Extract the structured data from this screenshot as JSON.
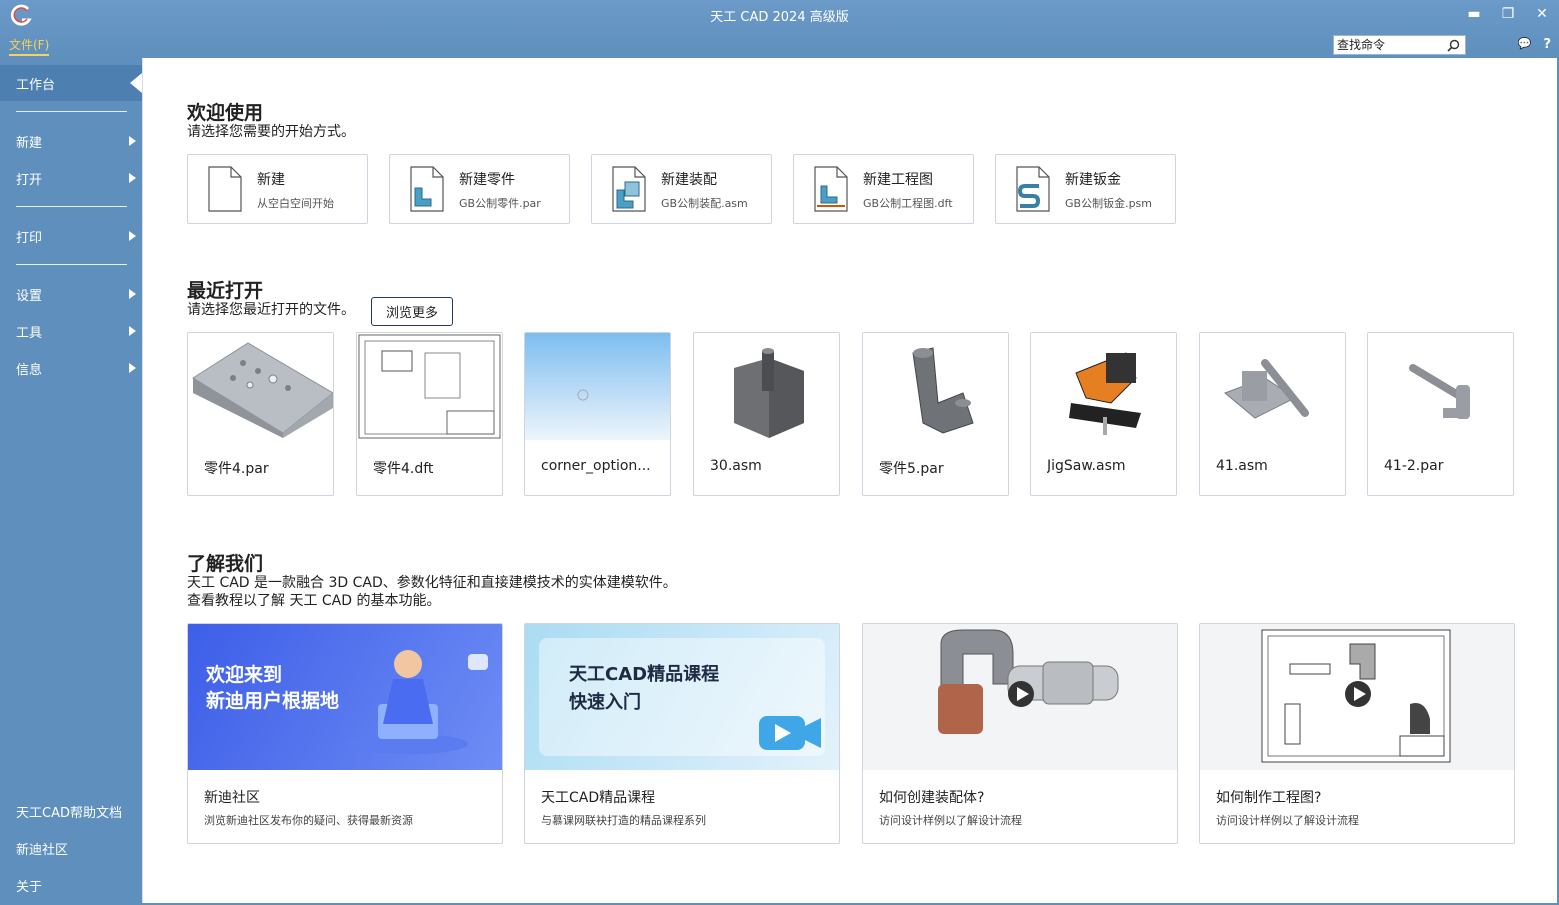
{
  "titlebar": {
    "title": "天工 CAD 2024 高级版",
    "file_menu": "文件(F)",
    "search_placeholder": "查找命令",
    "minimize": "▬",
    "maximize": "❐",
    "close": "✕",
    "chat": "💬",
    "help": "?"
  },
  "sidebar": {
    "items": [
      {
        "label": "工作台"
      },
      {
        "label": "新建"
      },
      {
        "label": "打开"
      },
      {
        "label": "打印"
      },
      {
        "label": "设置"
      },
      {
        "label": "工具"
      },
      {
        "label": "信息"
      }
    ],
    "bottom": [
      {
        "label": "天工CAD帮助文档"
      },
      {
        "label": "新迪社区"
      },
      {
        "label": "关于"
      }
    ]
  },
  "welcome": {
    "title": "欢迎使用",
    "subtitle": "请选择您需要的开始方式。",
    "cards": [
      {
        "title": "新建",
        "sub": "从空白空间开始",
        "icon": "blank-doc-icon"
      },
      {
        "title": "新建零件",
        "sub": "GB公制零件.par",
        "icon": "part-doc-icon"
      },
      {
        "title": "新建装配",
        "sub": "GB公制装配.asm",
        "icon": "assembly-doc-icon"
      },
      {
        "title": "新建工程图",
        "sub": "GB公制工程图.dft",
        "icon": "drawing-doc-icon"
      },
      {
        "title": "新建钣金",
        "sub": "GB公制钣金.psm",
        "icon": "sheetmetal-doc-icon"
      }
    ]
  },
  "recent": {
    "title": "最近打开",
    "subtitle": "请选择您最近打开的文件。",
    "browse_label": "浏览更多",
    "files": [
      {
        "name": "零件4.par"
      },
      {
        "name": "零件4.dft"
      },
      {
        "name": "corner_option..."
      },
      {
        "name": "30.asm"
      },
      {
        "name": "零件5.par"
      },
      {
        "name": "JigSaw.asm"
      },
      {
        "name": "41.asm"
      },
      {
        "name": "41-2.par"
      }
    ]
  },
  "about": {
    "title": "了解我们",
    "line1": "天工 CAD 是一款融合 3D CAD、参数化特征和直接建模技术的实体建模软件。",
    "line2": "查看教程以了解 天工 CAD 的基本功能。",
    "cards": [
      {
        "title": "新迪社区",
        "sub": "浏览新迪社区发布你的疑问、获得最新资源",
        "banner_line1": "欢迎来到",
        "banner_line2": "新迪用户根据地"
      },
      {
        "title": "天工CAD精品课程",
        "sub": "与慕课网联袂打造的精品课程系列",
        "banner_line1": "天工CAD精品课程",
        "banner_line2": "快速入门"
      },
      {
        "title": "如何创建装配体?",
        "sub": "访问设计样例以了解设计流程"
      },
      {
        "title": "如何制作工程图?",
        "sub": "访问设计样例以了解设计流程"
      }
    ]
  },
  "colors": {
    "titlebar": "#5f8fbd",
    "sidebar": "#5f8fbd",
    "sidebar_active": "#4d7fb1",
    "file_menu": "#f4d35e"
  }
}
